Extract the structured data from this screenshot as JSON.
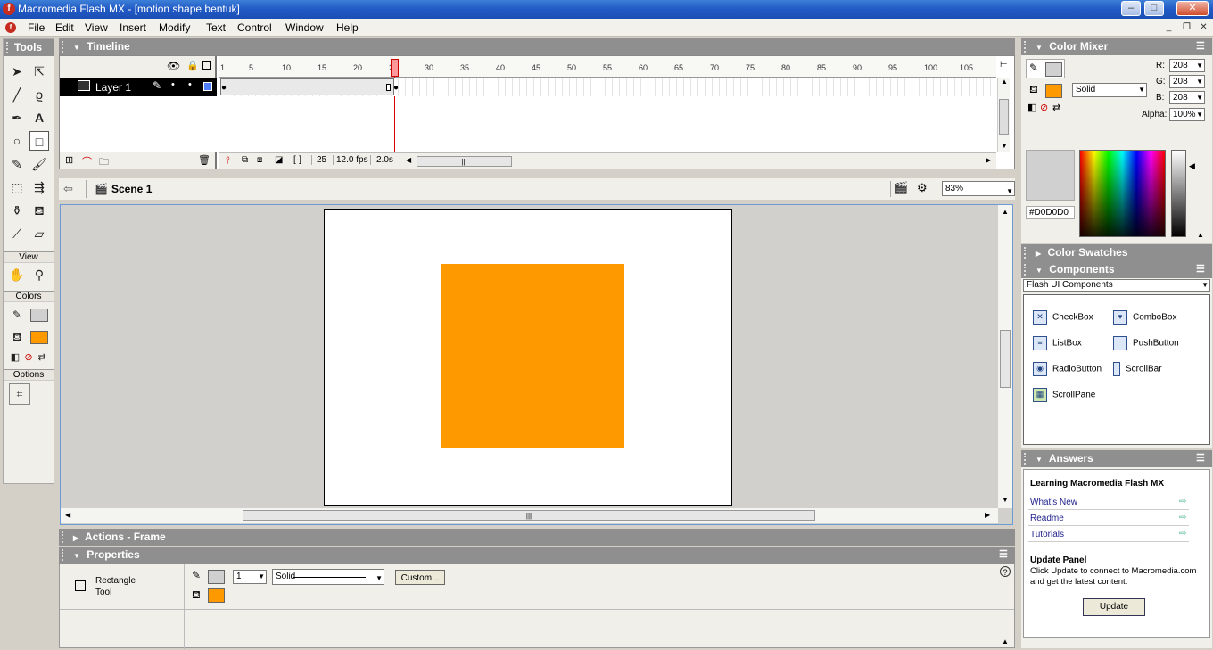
{
  "window": {
    "title": "Macromedia Flash MX - [motion shape bentuk]",
    "min": "–",
    "max": "□",
    "close": "✕"
  },
  "menu": [
    "File",
    "Edit",
    "View",
    "Insert",
    "Modify",
    "Text",
    "Control",
    "Window",
    "Help"
  ],
  "tools": {
    "title": "Tools",
    "view_label": "View",
    "colors_label": "Colors",
    "options_label": "Options",
    "stroke_color": "#d0d0d0",
    "fill_color": "#ff9900"
  },
  "timeline": {
    "title": "Timeline",
    "layer_name": "Layer 1",
    "frame_numbers": [
      "1",
      "5",
      "10",
      "15",
      "20",
      "25",
      "30",
      "35",
      "40",
      "45",
      "50",
      "55",
      "60",
      "65",
      "70",
      "75",
      "80",
      "85",
      "90",
      "95",
      "100",
      "105"
    ],
    "current_frame": "25",
    "fps": "12.0 fps",
    "time": "2.0s"
  },
  "scene": {
    "label": "Scene 1",
    "zoom": "83%"
  },
  "stage": {
    "shape_color": "#ff9900"
  },
  "actions": {
    "title": "Actions - Frame"
  },
  "properties": {
    "title": "Properties",
    "tool_name_1": "Rectangle",
    "tool_name_2": "Tool",
    "stroke_width": "1",
    "stroke_style": "Solid",
    "custom_button": "Custom..."
  },
  "color_mixer": {
    "title": "Color Mixer",
    "r_label": "R:",
    "r": "208",
    "g_label": "G:",
    "g": "208",
    "b_label": "B:",
    "b": "208",
    "alpha_label": "Alpha:",
    "alpha": "100%",
    "fill_type": "Solid",
    "hex": "#D0D0D0",
    "preview_color": "#d0d0d0"
  },
  "swatches": {
    "title": "Color Swatches"
  },
  "components": {
    "title": "Components",
    "set": "Flash UI Components",
    "items": [
      "CheckBox",
      "ComboBox",
      "ListBox",
      "PushButton",
      "RadioButton",
      "ScrollBar",
      "ScrollPane"
    ]
  },
  "answers": {
    "title": "Answers",
    "heading": "Learning Macromedia Flash MX",
    "links": [
      "What's New",
      "Readme",
      "Tutorials"
    ],
    "update_heading": "Update Panel",
    "update_text": "Click Update to connect to Macromedia.com and get the latest content.",
    "update_button": "Update"
  }
}
